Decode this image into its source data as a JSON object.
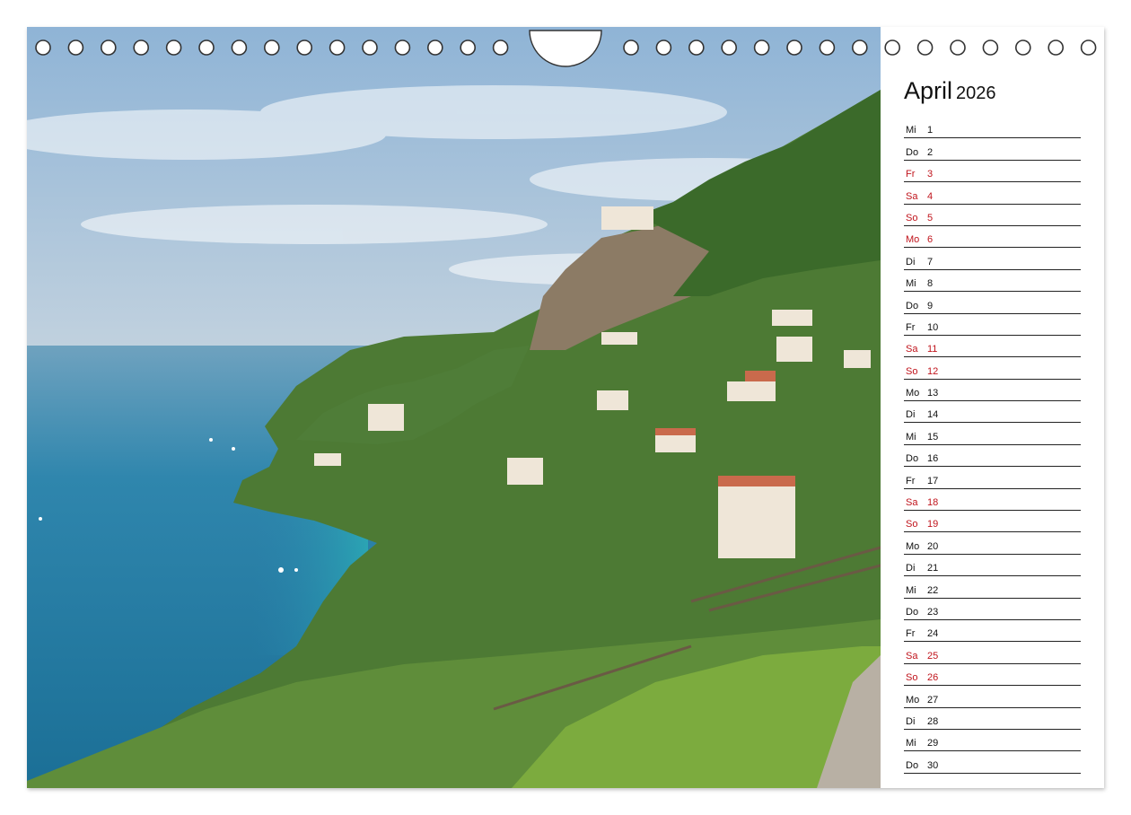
{
  "calendar": {
    "month": "April",
    "year": "2026",
    "accent_color": "#c0141c",
    "days": [
      {
        "wd": "Mi",
        "d": "1",
        "holiday": false
      },
      {
        "wd": "Do",
        "d": "2",
        "holiday": false
      },
      {
        "wd": "Fr",
        "d": "3",
        "holiday": true
      },
      {
        "wd": "Sa",
        "d": "4",
        "holiday": true
      },
      {
        "wd": "So",
        "d": "5",
        "holiday": true
      },
      {
        "wd": "Mo",
        "d": "6",
        "holiday": true
      },
      {
        "wd": "Di",
        "d": "7",
        "holiday": false
      },
      {
        "wd": "Mi",
        "d": "8",
        "holiday": false
      },
      {
        "wd": "Do",
        "d": "9",
        "holiday": false
      },
      {
        "wd": "Fr",
        "d": "10",
        "holiday": false
      },
      {
        "wd": "Sa",
        "d": "11",
        "holiday": true
      },
      {
        "wd": "So",
        "d": "12",
        "holiday": true
      },
      {
        "wd": "Mo",
        "d": "13",
        "holiday": false
      },
      {
        "wd": "Di",
        "d": "14",
        "holiday": false
      },
      {
        "wd": "Mi",
        "d": "15",
        "holiday": false
      },
      {
        "wd": "Do",
        "d": "16",
        "holiday": false
      },
      {
        "wd": "Fr",
        "d": "17",
        "holiday": false
      },
      {
        "wd": "Sa",
        "d": "18",
        "holiday": true
      },
      {
        "wd": "So",
        "d": "19",
        "holiday": true
      },
      {
        "wd": "Mo",
        "d": "20",
        "holiday": false
      },
      {
        "wd": "Di",
        "d": "21",
        "holiday": false
      },
      {
        "wd": "Mi",
        "d": "22",
        "holiday": false
      },
      {
        "wd": "Do",
        "d": "23",
        "holiday": false
      },
      {
        "wd": "Fr",
        "d": "24",
        "holiday": false
      },
      {
        "wd": "Sa",
        "d": "25",
        "holiday": true
      },
      {
        "wd": "So",
        "d": "26",
        "holiday": true
      },
      {
        "wd": "Mo",
        "d": "27",
        "holiday": false
      },
      {
        "wd": "Di",
        "d": "28",
        "holiday": false
      },
      {
        "wd": "Mi",
        "d": "29",
        "holiday": false
      },
      {
        "wd": "Do",
        "d": "30",
        "holiday": false
      }
    ]
  },
  "photo": {
    "subject": "coastal-hillside-landscape",
    "colors": {
      "sky": "#c9d6e2",
      "sea": "#2f8fb0",
      "hill": "#3f6b2e",
      "cliff": "#8a7a66"
    }
  }
}
